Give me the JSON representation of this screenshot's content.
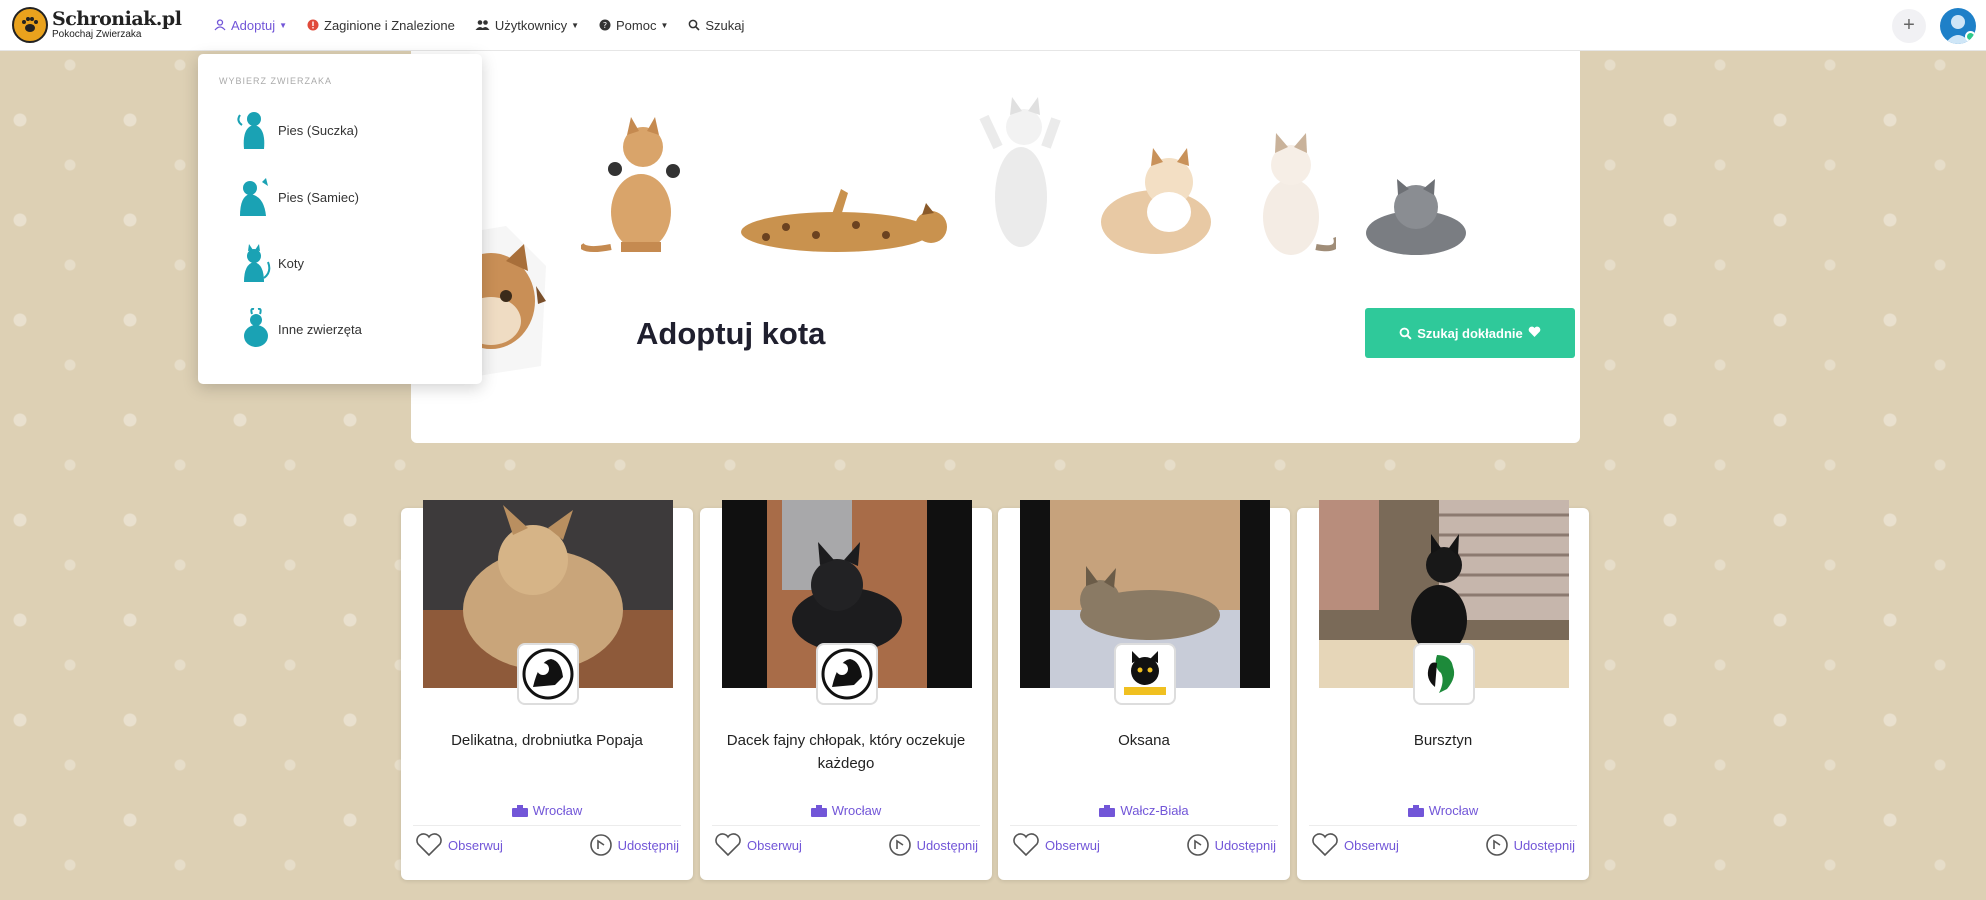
{
  "brand": {
    "title": "Schroniak.pl",
    "subtitle": "Pokochaj Zwierzaka"
  },
  "nav": {
    "items": [
      {
        "label": "Adoptuj",
        "icon": "user-icon",
        "caret": true,
        "active": true
      },
      {
        "label": "Zaginione i Znalezione",
        "icon": "alert-icon",
        "caret": false,
        "active": false
      },
      {
        "label": "Użytkownicy",
        "icon": "users-icon",
        "caret": true,
        "active": false
      },
      {
        "label": "Pomoc",
        "icon": "help-icon",
        "caret": true,
        "active": false
      },
      {
        "label": "Szukaj",
        "icon": "search-icon",
        "caret": false,
        "active": false
      }
    ],
    "plus": "+"
  },
  "dropdown": {
    "header": "Wybierz zwierzaka",
    "items": [
      {
        "label": "Pies (Suczka)",
        "icon": "dog-female-icon"
      },
      {
        "label": "Pies (Samiec)",
        "icon": "dog-male-icon"
      },
      {
        "label": "Koty",
        "icon": "cat-icon"
      },
      {
        "label": "Inne zwierzęta",
        "icon": "other-animals-icon"
      }
    ]
  },
  "hero": {
    "title": "Adoptuj kota",
    "button_label": "Szukaj dokładnie"
  },
  "cards": [
    {
      "title": "Delikatna, drobniutka Popaja",
      "location": "Wrocław",
      "observe": "Obserwuj",
      "share": "Udostępnij",
      "badge": "shelter-logo-dog-cat"
    },
    {
      "title": "Dacek fajny chłopak, który oczekuje każdego",
      "location": "Wrocław",
      "observe": "Obserwuj",
      "share": "Udostępnij",
      "badge": "shelter-logo-dog-cat"
    },
    {
      "title": "Oksana",
      "location": "Wałcz-Biała",
      "observe": "Obserwuj",
      "share": "Udostępnij",
      "badge": "shelter-logo-cat-face"
    },
    {
      "title": "Bursztyn",
      "location": "Wrocław",
      "observe": "Obserwuj",
      "share": "Udostępnij",
      "badge": "shelter-logo-green-bird"
    }
  ],
  "colors": {
    "accent": "#7256d8",
    "button": "#2fc99a",
    "background": "#ddd0b4",
    "teal_icon": "#1aa2b4"
  }
}
